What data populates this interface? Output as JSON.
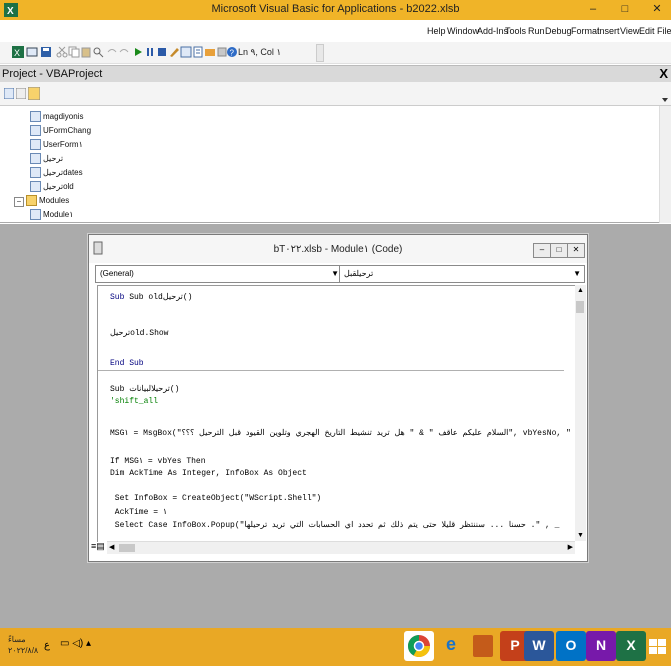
{
  "window": {
    "title": "Microsoft Visual Basic for Applications - b2022.xlsb",
    "minimize": "–",
    "restore": "□",
    "close": "✕"
  },
  "menubar": {
    "items": [
      "Help",
      "Window",
      "Add-Ins",
      "Tools",
      "Run",
      "Debug",
      "Format",
      "Insert",
      "View",
      "Edit",
      "File"
    ]
  },
  "toolbar": {
    "position_label": "Ln ٩, Col ١"
  },
  "project": {
    "title": "Project - VBAProject",
    "close": "X",
    "tree": [
      "magdiyonis",
      "UFormChang",
      "UserForm١",
      "ترحيل",
      "ترحيلdates",
      "ترحيلold",
      "Modules",
      "Module١"
    ]
  },
  "code_window": {
    "title": "bT٠٢٢.xlsb - Module١ (Code)",
    "object_combo": "(General)",
    "proc_combo": "ترحيلقبل",
    "lines": [
      "Sub oldترحيل()",
      "ترحيلold.Show",
      "End Sub",
      "Sub ترحيلالبيانات()",
      "'shift_all",
      "MSG١ = MsgBox(\"السلام عليكم عاقف \" & \" هل تريد تنشيط التاريخ الهجري وتلوين القيود قبل الترحيل ؟؟؟\", vbYesNo, \"",
      "If MSG١ = vbYes Then",
      "Dim AckTime As Integer, InfoBox As Object",
      " Set InfoBox = CreateObject(\"WScript.Shell\")",
      " AckTime = ١",
      " Select Case InfoBox.Popup(\"حسنا ... سننتظر قليلا حتى يتم ذلك ثم تحدد اي الحسابات التي تريد ترحيلها .\" , _"
    ]
  },
  "taskbar": {
    "time": "مساءً",
    "date": "٢٠٢٢/٨/٨",
    "lang": "ع",
    "apps": [
      "chrome",
      "internet-explorer",
      "unknown",
      "powerpoint",
      "word",
      "outlook",
      "onenote",
      "excel",
      "vba"
    ]
  },
  "colors": {
    "titlebar": "#f0b428",
    "taskbar": "#e9a825",
    "mdi": "#ababab",
    "keyword": "#00007f",
    "comment": "#007f00"
  }
}
